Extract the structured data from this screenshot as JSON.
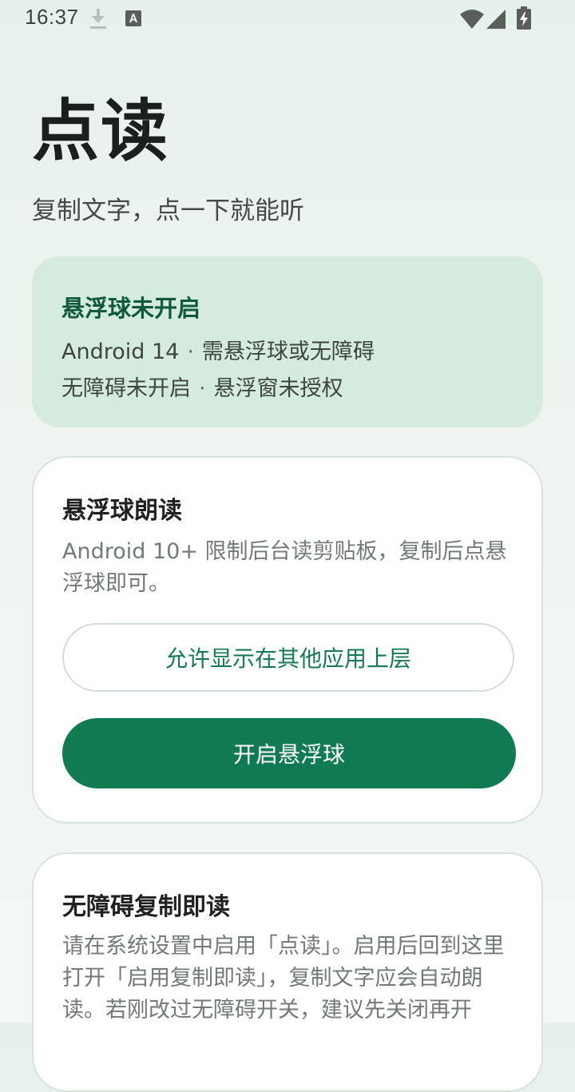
{
  "status_bar": {
    "time": "16:37",
    "icons": [
      "download-icon",
      "keyboard-a-icon",
      "wifi-icon",
      "cell-signal-icon",
      "battery-charging-icon"
    ]
  },
  "header": {
    "title": "点读",
    "subtitle": "复制文字，点一下就能听"
  },
  "status_card": {
    "heading": "悬浮球未开启",
    "line1_left": "Android 14",
    "line1_right": "需悬浮球或无障碍",
    "line2_left": "无障碍未开启",
    "line2_right": "悬浮窗未授权",
    "separator": "·"
  },
  "floating_card": {
    "title": "悬浮球朗读",
    "description": "Android 10+ 限制后台读剪贴板，复制后点悬浮球即可。",
    "overlay_button": "允许显示在其他应用上层",
    "enable_button": "开启悬浮球"
  },
  "accessibility_card": {
    "title": "无障碍复制即读",
    "description": "请在系统设置中启用「点读」。启用后回到这里打开「启用复制即读」，复制文字应会自动朗读。若刚改过无障碍开关，建议先关闭再开"
  },
  "colors": {
    "accent": "#107a52",
    "status_card_bg": "#d4ebde",
    "status_heading": "#0f5a3c"
  }
}
